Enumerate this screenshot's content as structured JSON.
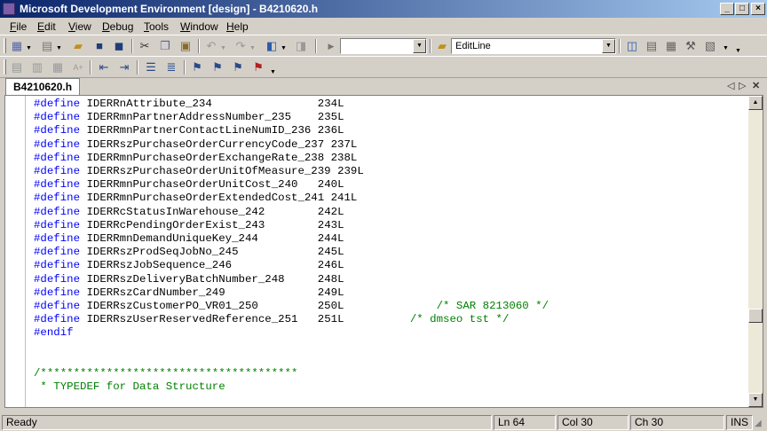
{
  "window": {
    "title": "Microsoft Development Environment [design] - B4210620.h",
    "minimize": "_",
    "maximize": "□",
    "close": "×"
  },
  "menu": {
    "items": [
      {
        "accel": "F",
        "rest": "ile"
      },
      {
        "accel": "E",
        "rest": "dit"
      },
      {
        "accel": "V",
        "rest": "iew"
      },
      {
        "accel": "D",
        "rest": "ebug"
      },
      {
        "accel": "T",
        "rest": "ools"
      },
      {
        "accel": "W",
        "rest": "indow"
      },
      {
        "accel": "H",
        "rest": "elp"
      }
    ]
  },
  "toolbar": {
    "find_combo_value": "",
    "method_combo_value": "EditLine"
  },
  "tabs": {
    "active": "B4210620.h",
    "prev": "◁",
    "next": "▷",
    "close": "✕"
  },
  "editor": {
    "lines": [
      {
        "kw": "#define",
        "ident": "IDERRnAttribute_234",
        "val": "234L",
        "comment": ""
      },
      {
        "kw": "#define",
        "ident": "IDERRmnPartnerAddressNumber_235",
        "val": "235L",
        "comment": ""
      },
      {
        "kw": "#define",
        "ident": "IDERRmnPartnerContactLineNumID_236",
        "val": "236L",
        "comment": ""
      },
      {
        "kw": "#define",
        "ident": "IDERRszPurchaseOrderCurrencyCode_237",
        "val": "237L",
        "comment": ""
      },
      {
        "kw": "#define",
        "ident": "IDERRmnPurchaseOrderExchangeRate_238",
        "val": "238L",
        "comment": ""
      },
      {
        "kw": "#define",
        "ident": "IDERRszPurchaseOrderUnitOfMeasure_239",
        "val": "239L",
        "comment": ""
      },
      {
        "kw": "#define",
        "ident": "IDERRmnPurchaseOrderUnitCost_240",
        "val": "240L",
        "comment": ""
      },
      {
        "kw": "#define",
        "ident": "IDERRmnPurchaseOrderExtendedCost_241",
        "val": "241L",
        "comment": ""
      },
      {
        "kw": "#define",
        "ident": "IDERRcStatusInWarehouse_242",
        "val": "242L",
        "comment": ""
      },
      {
        "kw": "#define",
        "ident": "IDERRcPendingOrderExist_243",
        "val": "243L",
        "comment": ""
      },
      {
        "kw": "#define",
        "ident": "IDERRmnDemandUniqueKey_244",
        "val": "244L",
        "comment": ""
      },
      {
        "kw": "#define",
        "ident": "IDERRszProdSeqJobNo_245",
        "val": "245L",
        "comment": ""
      },
      {
        "kw": "#define",
        "ident": "IDERRszJobSequence_246",
        "val": "246L",
        "comment": ""
      },
      {
        "kw": "#define",
        "ident": "IDERRszDeliveryBatchNumber_248",
        "val": "248L",
        "comment": ""
      },
      {
        "kw": "#define",
        "ident": "IDERRszCardNumber_249",
        "val": "249L",
        "comment": ""
      },
      {
        "kw": "#define",
        "ident": "IDERRszCustomerPO_VR01_250",
        "val": "250L",
        "comment": "              /* SAR 8213060 */"
      },
      {
        "kw": "#define",
        "ident": "IDERRszUserReservedReference_251",
        "val": "251L",
        "comment": "          /* dmseo tst */"
      },
      {
        "kw": "#endif",
        "ident": "",
        "val": "",
        "comment": ""
      },
      {
        "kw": "",
        "ident": "",
        "val": "",
        "comment": ""
      },
      {
        "kw": "",
        "ident": "",
        "val": "",
        "comment": ""
      },
      {
        "kw": "",
        "ident": "",
        "val": "",
        "comment": "/***************************************"
      },
      {
        "kw": "",
        "ident": "",
        "val": "",
        "comment": " * TYPEDEF for Data Structure"
      }
    ]
  },
  "status": {
    "ready": "Ready",
    "line": "Ln 64",
    "col": "Col 30",
    "ch": "Ch 30",
    "ins": "INS"
  }
}
